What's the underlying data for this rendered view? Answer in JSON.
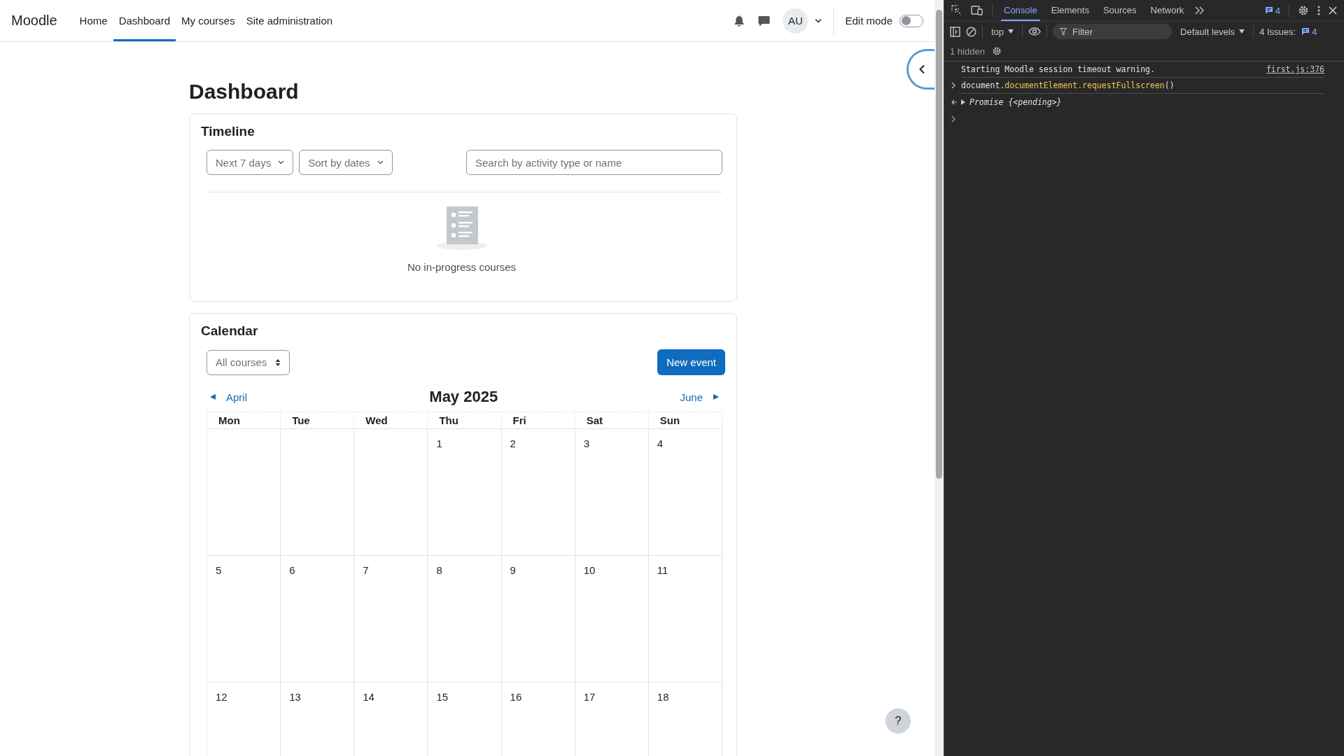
{
  "navbar": {
    "brand": "Moodle",
    "items": [
      {
        "label": "Home",
        "selected": false
      },
      {
        "label": "Dashboard",
        "selected": true
      },
      {
        "label": "My courses",
        "selected": false
      },
      {
        "label": "Site administration",
        "selected": false
      }
    ],
    "avatar": "AU",
    "edit_mode": {
      "label": "Edit mode",
      "on": false
    }
  },
  "page_title": "Dashboard",
  "timeline": {
    "title": "Timeline",
    "filters": [
      "Next 7 days",
      "Sort by dates"
    ],
    "search": {
      "placeholder": "Search by activity type or name"
    },
    "empty_text": "No in-progress courses"
  },
  "calendar": {
    "title": "Calendar",
    "course_select": "All courses",
    "new_event": "New event",
    "prev": "April",
    "month": "May 2025",
    "next": "June",
    "weekdays": [
      "Mon",
      "Tue",
      "Wed",
      "Thu",
      "Fri",
      "Sat",
      "Sun"
    ],
    "weeks": [
      {
        "cells": [
          {
            "kind": "blank"
          },
          {
            "kind": "blank"
          },
          {
            "kind": "blank"
          },
          {
            "kind": "day",
            "label": "1"
          },
          {
            "kind": "day",
            "label": "2"
          },
          {
            "kind": "day",
            "label": "3"
          },
          {
            "kind": "day",
            "label": "4"
          }
        ]
      },
      {
        "cells": [
          {
            "kind": "day",
            "label": "5"
          },
          {
            "kind": "day",
            "label": "6"
          },
          {
            "kind": "day",
            "label": "7"
          },
          {
            "kind": "day",
            "label": "8"
          },
          {
            "kind": "day",
            "label": "9"
          },
          {
            "kind": "day",
            "label": "10"
          },
          {
            "kind": "day",
            "label": "11"
          }
        ]
      },
      {
        "cells": [
          {
            "kind": "day",
            "label": "12"
          },
          {
            "kind": "day",
            "label": "13"
          },
          {
            "kind": "day",
            "label": "14"
          },
          {
            "kind": "day",
            "label": "15"
          },
          {
            "kind": "day",
            "label": "16"
          },
          {
            "kind": "day",
            "label": "17"
          },
          {
            "kind": "day",
            "label": "18"
          }
        ]
      }
    ]
  },
  "help": "?",
  "devtools": {
    "tabs": [
      {
        "label": "Console",
        "selected": true
      },
      {
        "label": "Elements",
        "selected": false
      },
      {
        "label": "Sources",
        "selected": false
      },
      {
        "label": "Network",
        "selected": false
      }
    ],
    "message_count": "4",
    "context": "top",
    "filter": {
      "placeholder": "Filter"
    },
    "levels": "Default levels",
    "issues_label": "4 Issues:",
    "issues_count": "4",
    "hidden": "1 hidden",
    "console": [
      {
        "kind": "log",
        "text": "Starting Moodle session timeout warning.",
        "source": "first.js:376"
      },
      {
        "kind": "input",
        "parts": [
          {
            "text": "document.",
            "kind": "plain"
          },
          {
            "text": "documentElement.requestFullscreen",
            "kind": "prop"
          },
          {
            "text": "()",
            "kind": "plain"
          }
        ]
      },
      {
        "kind": "output",
        "text": "Promise {<pending>}"
      },
      {
        "kind": "prompt"
      }
    ]
  }
}
